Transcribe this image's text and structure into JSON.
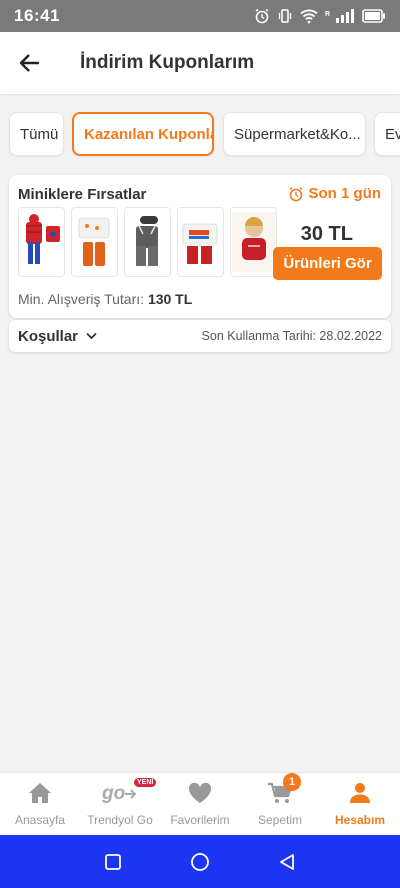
{
  "status_bar": {
    "time": "16:41"
  },
  "header": {
    "title": "İndirim Kuponlarım"
  },
  "tabs": [
    {
      "label": "Tümü"
    },
    {
      "label": "Kazanılan Kuponlar"
    },
    {
      "label": "Süpermarket&Ko..."
    },
    {
      "label": "Ev"
    }
  ],
  "coupon": {
    "title": "Miniklere Fırsatlar",
    "deadline": "Son 1 gün",
    "amount": "30 TL",
    "button_label": "Ürünleri Gör",
    "min_label": "Min. Alışveriş Tutarı:",
    "min_value": "130 TL"
  },
  "conditions": {
    "label": "Koşullar",
    "expiry": "Son Kullanma Tarihi: 28.02.2022"
  },
  "bottom_nav": {
    "items": [
      {
        "label": "Anasayfa",
        "icon": "home-icon"
      },
      {
        "label": "Trendyol Go",
        "icon": "go-logo-icon",
        "badge": "YENİ"
      },
      {
        "label": "Favorilerim",
        "icon": "heart-icon"
      },
      {
        "label": "Sepetim",
        "icon": "cart-icon",
        "badge": "1"
      },
      {
        "label": "Hesabım",
        "icon": "user-icon"
      }
    ]
  },
  "colors": {
    "accent": "#f27a1a",
    "android_nav": "#1c35f5",
    "status_bar": "#7a7a7a"
  }
}
